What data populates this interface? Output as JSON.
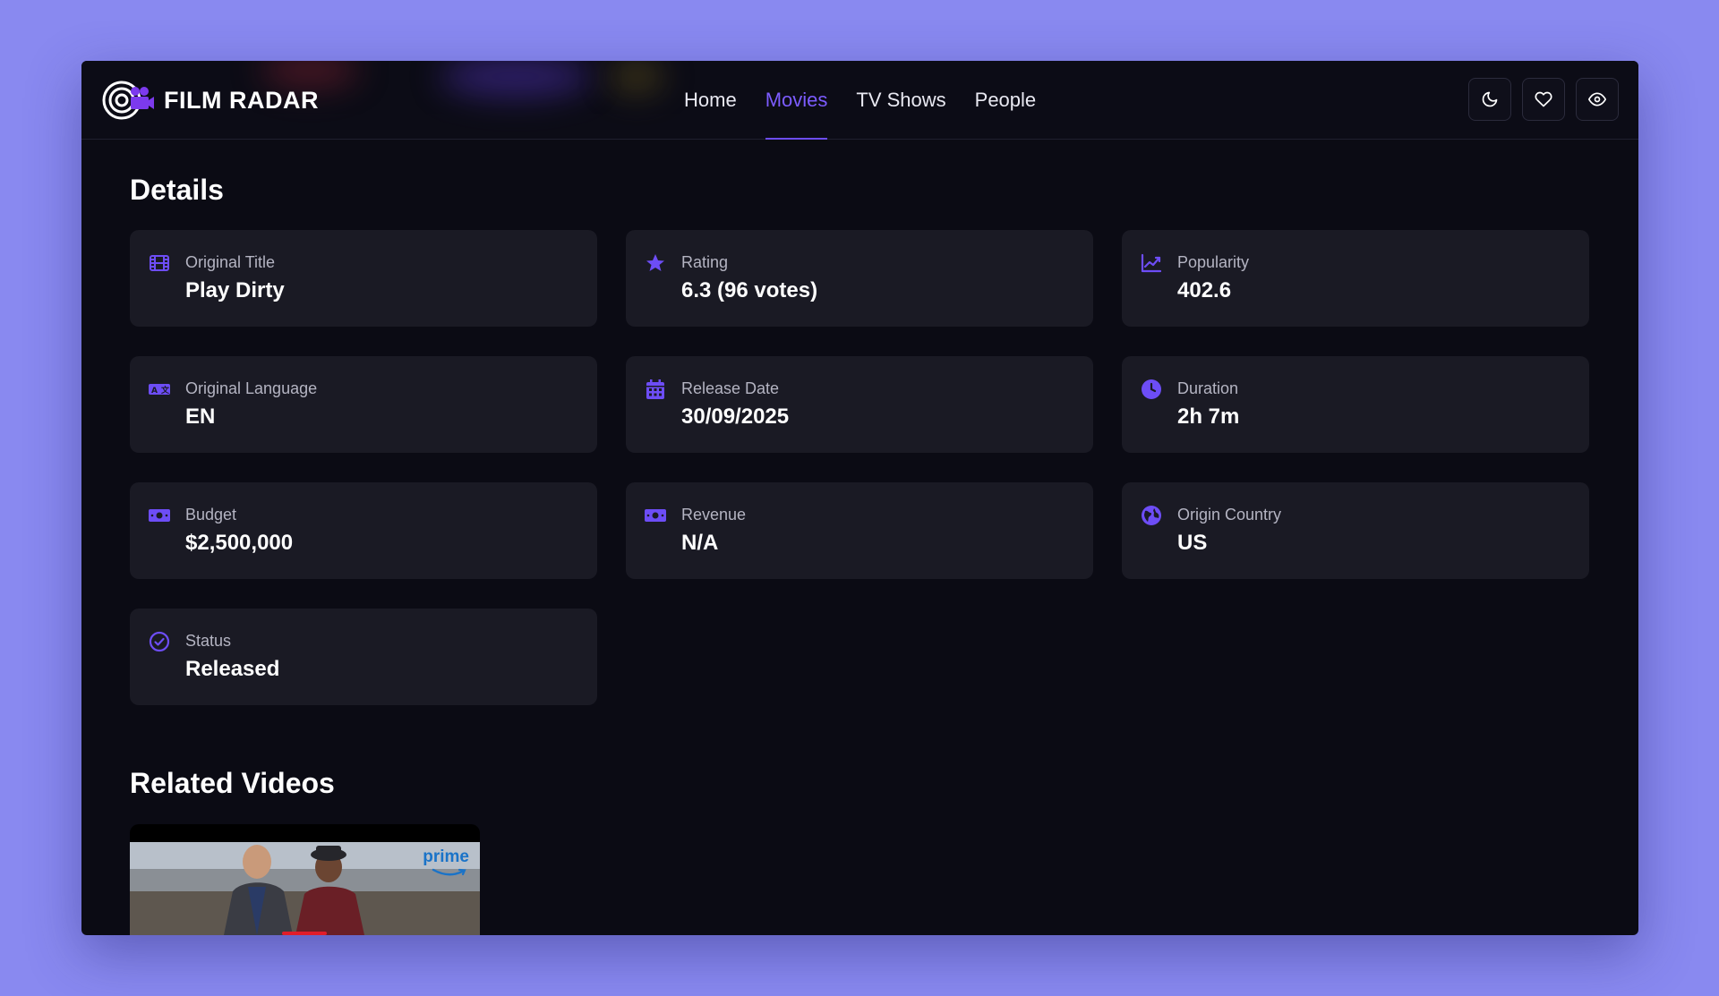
{
  "app": {
    "name": "FILM RADAR"
  },
  "nav": {
    "items": [
      {
        "label": "Home",
        "active": false
      },
      {
        "label": "Movies",
        "active": true
      },
      {
        "label": "TV Shows",
        "active": false
      },
      {
        "label": "People",
        "active": false
      }
    ]
  },
  "header_actions": [
    {
      "icon": "moon-icon"
    },
    {
      "icon": "heart-icon"
    },
    {
      "icon": "eye-icon"
    }
  ],
  "details": {
    "title": "Details",
    "items": [
      {
        "icon": "film-icon",
        "label": "Original Title",
        "value": "Play Dirty"
      },
      {
        "icon": "star-icon",
        "label": "Rating",
        "value": "6.3 (96 votes)"
      },
      {
        "icon": "chart-line-icon",
        "label": "Popularity",
        "value": "402.6"
      },
      {
        "icon": "language-icon",
        "label": "Original Language",
        "value": "EN"
      },
      {
        "icon": "calendar-icon",
        "label": "Release Date",
        "value": "30/09/2025"
      },
      {
        "icon": "clock-icon",
        "label": "Duration",
        "value": "2h 7m"
      },
      {
        "icon": "money-icon",
        "label": "Budget",
        "value": "$2,500,000"
      },
      {
        "icon": "money-icon",
        "label": "Revenue",
        "value": "N/A"
      },
      {
        "icon": "globe-icon",
        "label": "Origin Country",
        "value": "US"
      },
      {
        "icon": "check-circle-icon",
        "label": "Status",
        "value": "Released"
      }
    ]
  },
  "related": {
    "title": "Related Videos",
    "videos": [
      {
        "badge": "prime"
      }
    ]
  },
  "colors": {
    "accent": "#6d4df6",
    "background": "#0b0b14",
    "card": "#1a1a24",
    "page": "#8989f0"
  }
}
